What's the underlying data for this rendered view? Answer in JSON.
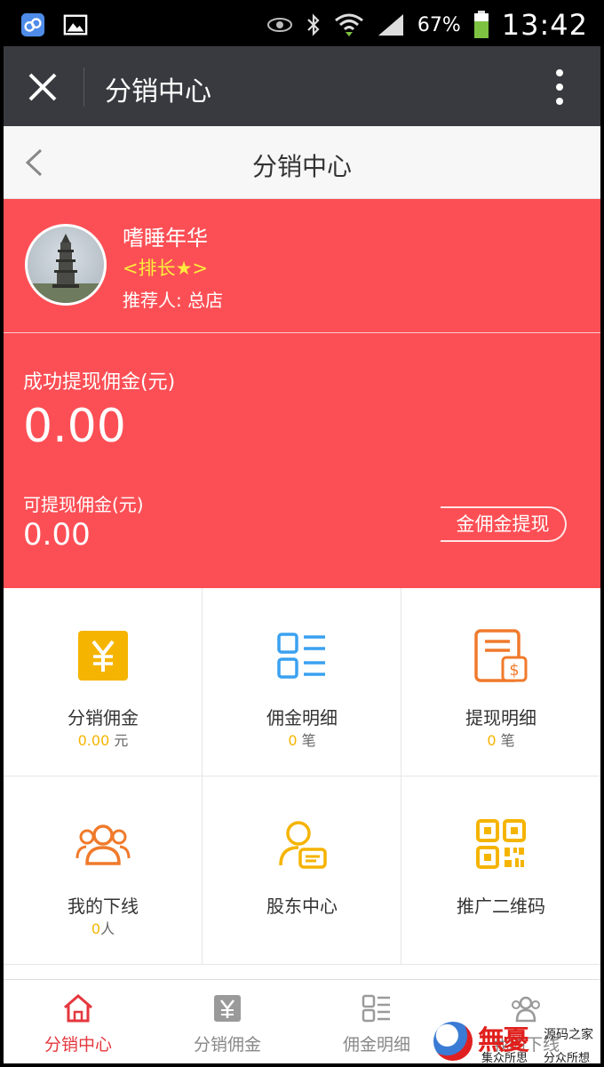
{
  "status_bar": {
    "battery_percent": "67%",
    "time": "13:42",
    "icons": [
      "app-icon",
      "gallery-icon",
      "eye-icon",
      "bluetooth-icon",
      "wifi-icon",
      "signal-icon",
      "battery-icon"
    ]
  },
  "wechat_bar": {
    "title": "分销中心",
    "icons": [
      "close-icon",
      "more-icon"
    ]
  },
  "page_header": {
    "title": "分销中心"
  },
  "profile": {
    "nickname": "嗜睡年华",
    "rank": "<排长★>",
    "referrer": "推荐人: 总店"
  },
  "commission": {
    "success_label": "成功提现佣金(元)",
    "success_amount": "0.00",
    "available_label": "可提现佣金(元)",
    "available_amount": "0.00",
    "withdraw_button": "金佣金提现"
  },
  "grid": [
    {
      "label": "分销佣金",
      "value": "0.00",
      "unit": "元",
      "icon": "yuan-icon",
      "color": "#f5b400"
    },
    {
      "label": "佣金明细",
      "value": "0",
      "unit": "笔",
      "icon": "list-icon",
      "color": "#3aa1f0"
    },
    {
      "label": "提现明细",
      "value": "0",
      "unit": "笔",
      "icon": "withdraw-record-icon",
      "color": "#f07a2b"
    },
    {
      "label": "我的下线",
      "value": "0",
      "unit": "人",
      "icon": "team-icon",
      "color": "#f07a2b"
    },
    {
      "label": "股东中心",
      "icon": "shareholder-icon",
      "color": "#f5b400"
    },
    {
      "label": "推广二维码",
      "icon": "qrcode-icon",
      "color": "#f5b400"
    }
  ],
  "tabbar": [
    {
      "label": "分销中心",
      "icon": "home-icon",
      "active": true
    },
    {
      "label": "分销佣金",
      "icon": "yuan-icon",
      "active": false
    },
    {
      "label": "佣金明细",
      "icon": "list-icon",
      "active": false
    },
    {
      "label": "我的下线",
      "icon": "team-icon",
      "active": false
    }
  ],
  "watermark": {
    "big": "無憂",
    "right_top": "源码之家",
    "left_small": "集众所思",
    "right_small": "分众所想"
  },
  "colors": {
    "accent_red": "#fc4f55",
    "rank_yellow": "#ffec3d",
    "wechat_bar": "#393a3f",
    "tab_active": "#e5373d"
  }
}
